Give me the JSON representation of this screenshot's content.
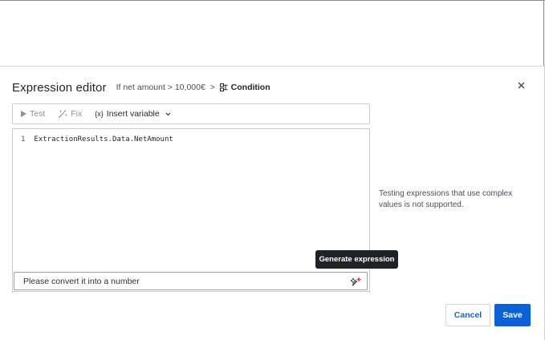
{
  "dialog": {
    "title": "Expression editor",
    "breadcrumb": {
      "step": "If net amount > 10,000€",
      "separator": ">",
      "current": "Condition"
    },
    "close_icon": "close-icon"
  },
  "toolbar": {
    "test_label": "Test",
    "fix_label": "Fix",
    "insert_variable_label": "Insert variable",
    "insert_variable_glyph": "{x}"
  },
  "editor": {
    "lines": [
      {
        "number": "1",
        "code": "ExtractionResults.Data.NetAmount"
      }
    ]
  },
  "prompt": {
    "value": "Please convert it into a number",
    "tooltip": "Generate expression"
  },
  "info_text": "Testing expressions that use complex values is not supported.",
  "footer": {
    "cancel_label": "Cancel",
    "save_label": "Save"
  },
  "colors": {
    "accent": "#0a62d6",
    "link": "#1e64c8",
    "tooltip_bg": "#1f2328"
  }
}
